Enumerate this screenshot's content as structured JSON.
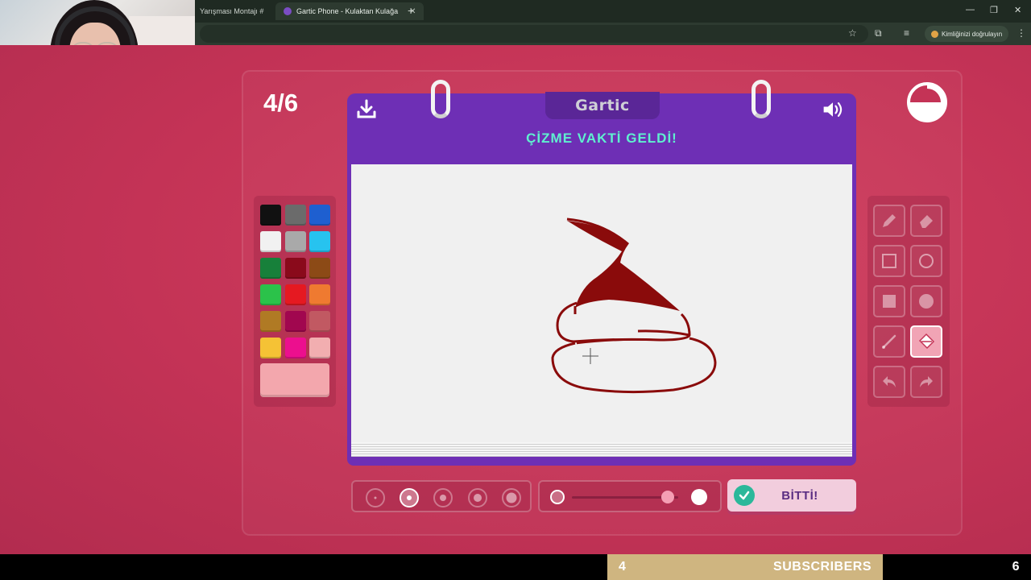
{
  "browser": {
    "tabs": [
      {
        "title": "Yarışması Montajı #",
        "active": false
      },
      {
        "title": "Gartic Phone - Kulaktan Kulağa",
        "active": true
      }
    ],
    "verify_label": "Kimliğinizi doğrulayın"
  },
  "game": {
    "round": "4/6",
    "logo": "Gartic",
    "prompt": "ÇİZME VAKTİ GELDİ!",
    "timer_remaining_fraction": 0.75,
    "palette": [
      "#111111",
      "#6b6b6b",
      "#1e5fd0",
      "#f1f1f1",
      "#a9a9a9",
      "#27c3ef",
      "#17803a",
      "#8a0a1b",
      "#8c4a16",
      "#2bc24a",
      "#e51921",
      "#ef7a30",
      "#b07a24",
      "#a1074f",
      "#c15962",
      "#f5c235",
      "#ec0f8e",
      "#f2aeb0"
    ],
    "selected_color": "#f3a7ad",
    "tools": [
      "pencil-icon",
      "eraser-icon",
      "rect-outline-icon",
      "circle-outline-icon",
      "rect-fill-icon",
      "circle-fill-icon",
      "line-icon",
      "fill-bucket-icon",
      "undo-icon",
      "redo-icon"
    ],
    "active_tool": "fill-bucket-icon",
    "brush_sizes": 5,
    "selected_brush_index": 1,
    "opacity_level": 0.9,
    "done_label": "BİTTİ!"
  },
  "footer": {
    "count_left": "4",
    "label": "SUBSCRIBERS",
    "count_right": "6"
  }
}
